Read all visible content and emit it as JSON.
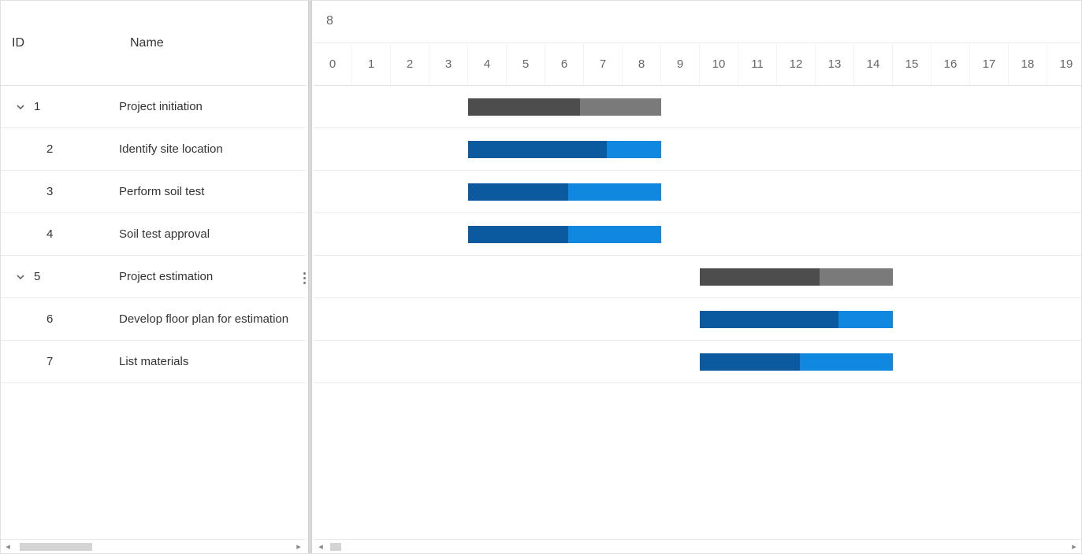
{
  "columns": {
    "id": "ID",
    "name": "Name"
  },
  "timeline": {
    "topLabel": "8",
    "unitWidth": 49,
    "ticks": [
      "0",
      "1",
      "2",
      "3",
      "4",
      "5",
      "6",
      "7",
      "8",
      "9",
      "10",
      "11",
      "12",
      "13",
      "14",
      "15",
      "16",
      "17",
      "18",
      "19"
    ]
  },
  "rows": [
    {
      "id": "1",
      "name": "Project initiation",
      "level": 0,
      "expandable": true,
      "start": 4,
      "end": 9,
      "progress": 0.58,
      "type": "parent"
    },
    {
      "id": "2",
      "name": "Identify site location",
      "level": 1,
      "expandable": false,
      "start": 4,
      "end": 9,
      "progress": 0.72,
      "type": "child"
    },
    {
      "id": "3",
      "name": "Perform soil test",
      "level": 1,
      "expandable": false,
      "start": 4,
      "end": 9,
      "progress": 0.52,
      "type": "child"
    },
    {
      "id": "4",
      "name": "Soil test approval",
      "level": 1,
      "expandable": false,
      "start": 4,
      "end": 9,
      "progress": 0.52,
      "type": "child"
    },
    {
      "id": "5",
      "name": "Project estimation",
      "level": 0,
      "expandable": true,
      "start": 10,
      "end": 15,
      "progress": 0.62,
      "type": "parent"
    },
    {
      "id": "6",
      "name": "Develop floor plan for estimation",
      "level": 1,
      "expandable": false,
      "start": 10,
      "end": 15,
      "progress": 0.72,
      "type": "child"
    },
    {
      "id": "7",
      "name": "List materials",
      "level": 1,
      "expandable": false,
      "start": 10,
      "end": 15,
      "progress": 0.52,
      "type": "child"
    }
  ],
  "colors": {
    "parentBar": "#7a7a7a",
    "parentProgress": "#4d4d4d",
    "childBar": "#1088e0",
    "childProgress": "#0b5aa0"
  }
}
